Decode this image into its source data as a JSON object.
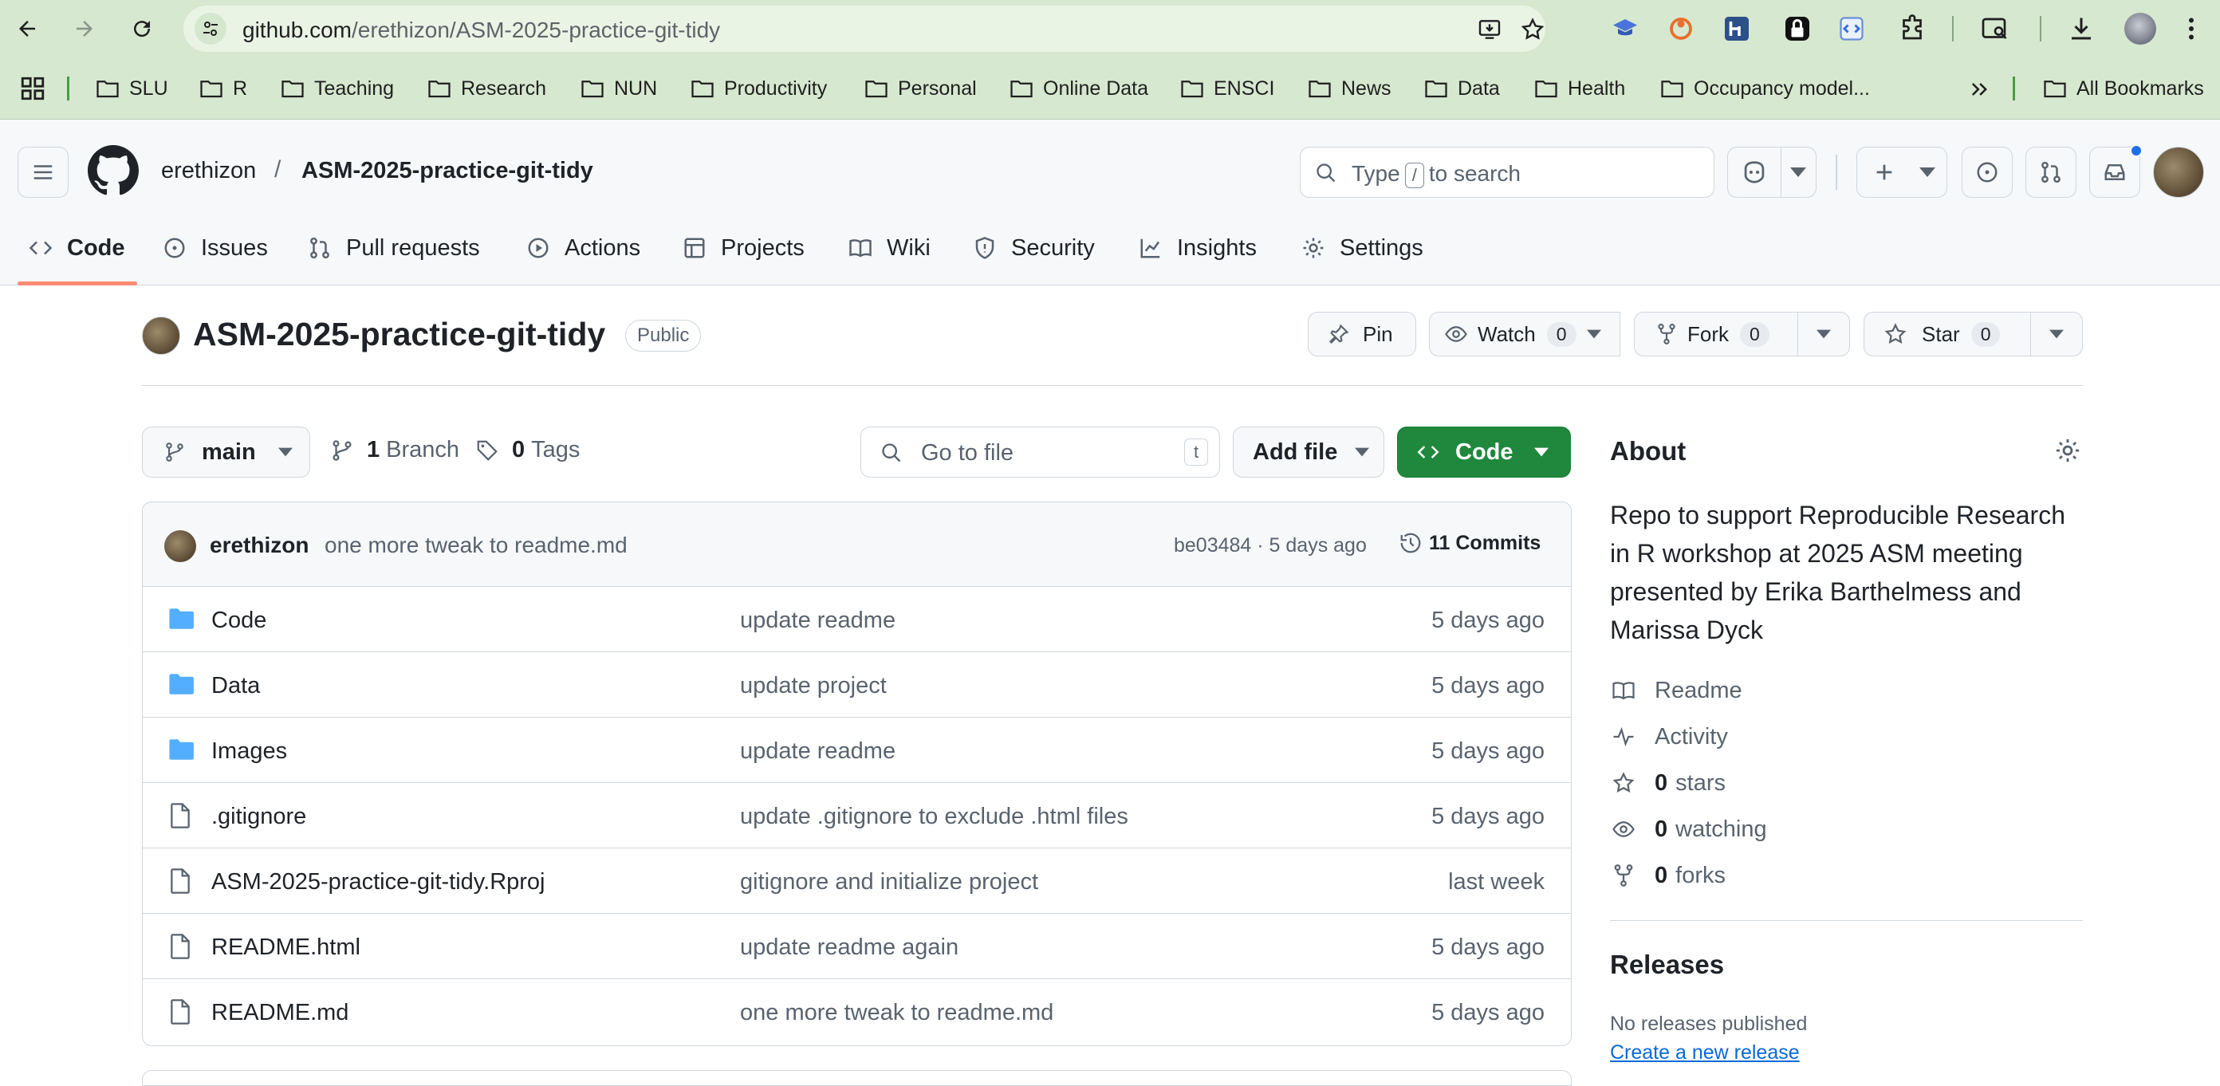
{
  "browser": {
    "url_host": "github.com",
    "url_path": "/erethizon/ASM-2025-practice-git-tidy",
    "bookmarks": [
      "SLU",
      "R",
      "Teaching",
      "Research",
      "NUN",
      "Productivity",
      "Personal",
      "Online Data",
      "ENSCI",
      "News",
      "Data",
      "Health",
      "Occupancy model..."
    ],
    "all_bookmarks": "All Bookmarks"
  },
  "header": {
    "owner": "erethizon",
    "separator": "/",
    "repo": "ASM-2025-practice-git-tidy",
    "search_prefix": "Type",
    "search_key": "/",
    "search_suffix": "to search"
  },
  "tabs": [
    {
      "label": "Code",
      "icon": "code-icon"
    },
    {
      "label": "Issues",
      "icon": "issue-icon"
    },
    {
      "label": "Pull requests",
      "icon": "pull-request-icon"
    },
    {
      "label": "Actions",
      "icon": "play-icon"
    },
    {
      "label": "Projects",
      "icon": "table-icon"
    },
    {
      "label": "Wiki",
      "icon": "book-icon"
    },
    {
      "label": "Security",
      "icon": "shield-icon"
    },
    {
      "label": "Insights",
      "icon": "graph-icon"
    },
    {
      "label": "Settings",
      "icon": "gear-icon"
    }
  ],
  "repo": {
    "title": "ASM-2025-practice-git-tidy",
    "visibility": "Public",
    "pin_label": "Pin",
    "watch_label": "Watch",
    "watch_count": "0",
    "fork_label": "Fork",
    "fork_count": "0",
    "star_label": "Star",
    "star_count": "0"
  },
  "toolbar": {
    "branch": "main",
    "branches_count": "1",
    "branches_label": "Branch",
    "tags_count": "0",
    "tags_label": "Tags",
    "goto_placeholder": "Go to file",
    "goto_key": "t",
    "add_file_label": "Add file",
    "code_label": "Code"
  },
  "latest_commit": {
    "author": "erethizon",
    "message": "one more tweak to readme.md",
    "meta": "be03484 · 5 days ago",
    "commits_label": "11 Commits"
  },
  "files": [
    {
      "name": "Code",
      "type": "folder",
      "message": "update readme",
      "date": "5 days ago"
    },
    {
      "name": "Data",
      "type": "folder",
      "message": "update project",
      "date": "5 days ago"
    },
    {
      "name": "Images",
      "type": "folder",
      "message": "update readme",
      "date": "5 days ago"
    },
    {
      "name": ".gitignore",
      "type": "file",
      "message": "update .gitignore to exclude .html files",
      "date": "5 days ago"
    },
    {
      "name": "ASM-2025-practice-git-tidy.Rproj",
      "type": "file",
      "message": "gitignore and initialize project",
      "date": "last week"
    },
    {
      "name": "README.html",
      "type": "file",
      "message": "update readme again",
      "date": "5 days ago"
    },
    {
      "name": "README.md",
      "type": "file",
      "message": "one more tweak to readme.md",
      "date": "5 days ago"
    }
  ],
  "about": {
    "heading": "About",
    "description": "Repo to support Reproducible Research in R workshop at 2025 ASM meeting presented by Erika Barthelmess and Marissa Dyck",
    "readme": "Readme",
    "activity": "Activity",
    "stars_count": "0",
    "stars_label": "stars",
    "watching_count": "0",
    "watching_label": "watching",
    "forks_count": "0",
    "forks_label": "forks"
  },
  "releases": {
    "heading": "Releases",
    "none": "No releases published",
    "create_link": "Create a new release"
  },
  "colors": {
    "accent_green": "#1f883d",
    "link_blue": "#0969da",
    "folder_blue": "#54aeff",
    "tab_underline": "#fd8c73",
    "chrome_green": "#d6e8cf"
  }
}
